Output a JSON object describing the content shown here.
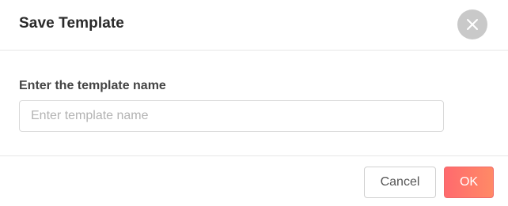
{
  "dialog": {
    "title": "Save Template",
    "close_icon": "close-icon"
  },
  "form": {
    "label": "Enter the template name",
    "input_value": "",
    "input_placeholder": "Enter template name"
  },
  "footer": {
    "cancel_label": "Cancel",
    "ok_label": "OK"
  },
  "colors": {
    "ok_gradient_start": "#ff6a6e",
    "ok_gradient_end": "#ff8a66",
    "close_bg": "#c9c9c9"
  }
}
